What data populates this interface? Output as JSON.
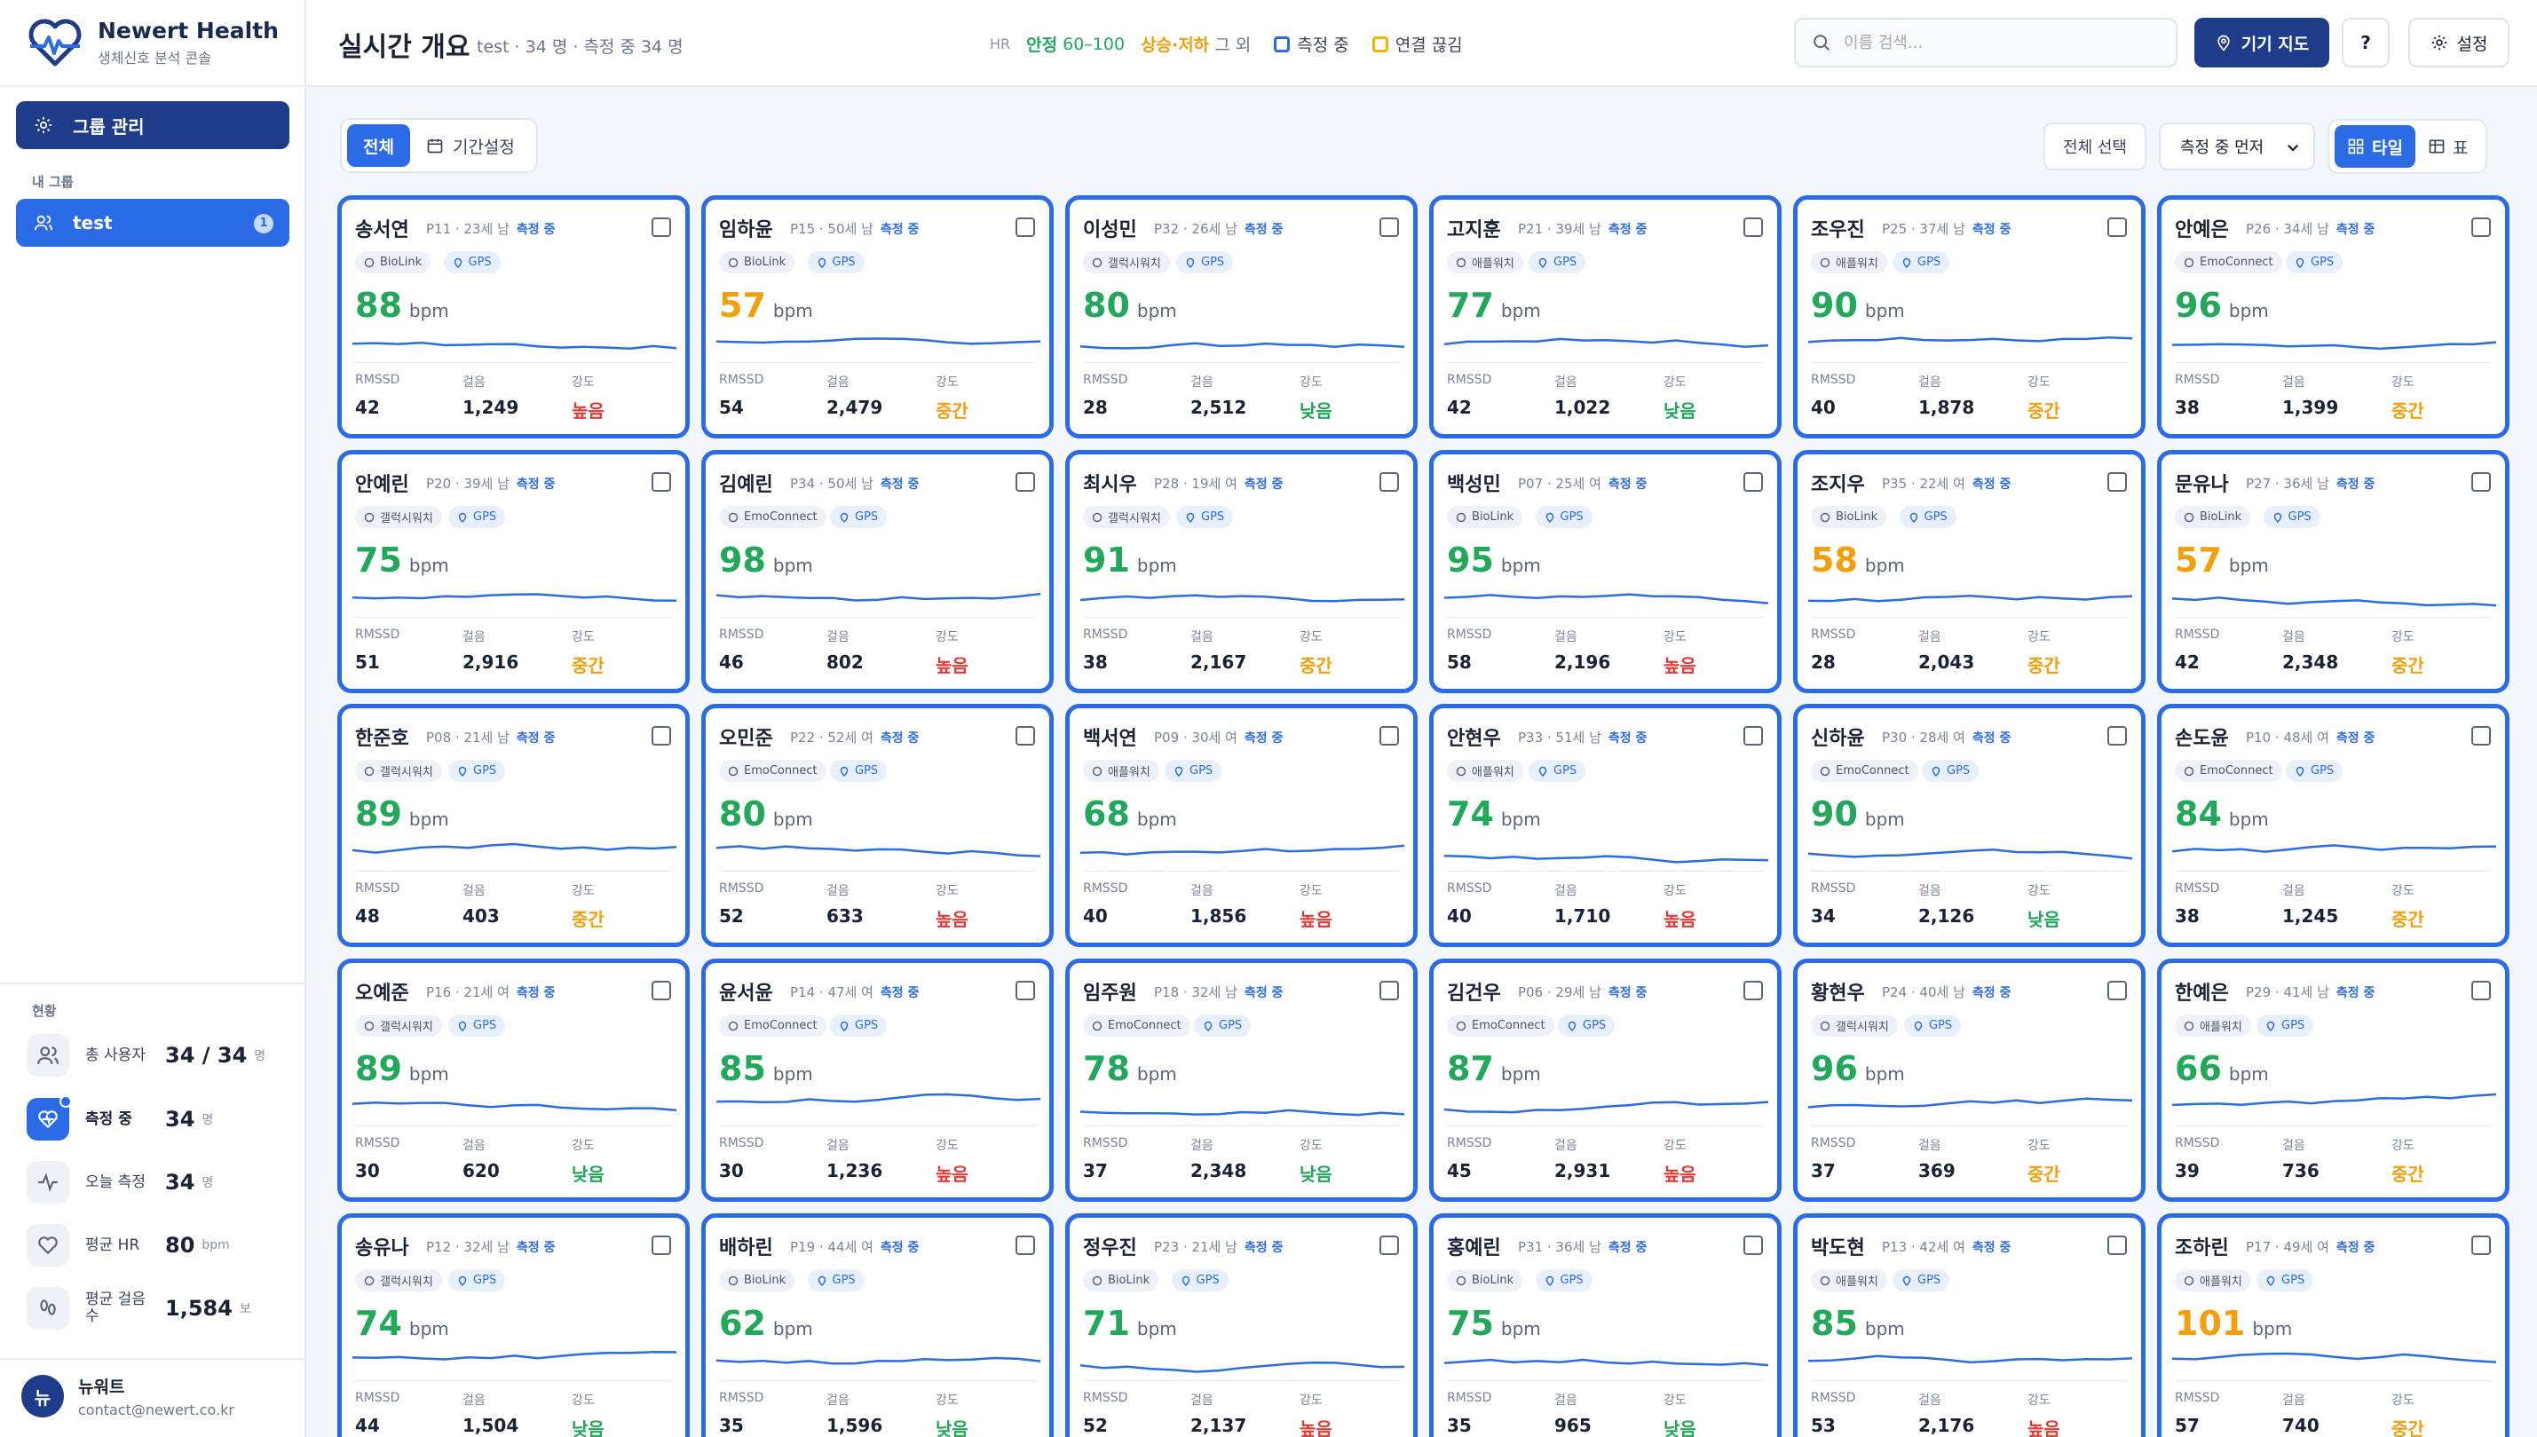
{
  "brand": {
    "name": "Newert Health",
    "subtitle": "생체신호 분석 콘솔"
  },
  "sidebar": {
    "manage_label": "그룹 관리",
    "my_groups_label": "내 그룹",
    "groups": [
      {
        "label": "test",
        "count": "1"
      }
    ],
    "status_label": "현황",
    "stats": [
      {
        "icon": "users-icon",
        "label": "총 사용자",
        "value": "34 / 34",
        "unit": "명"
      },
      {
        "icon": "heart-pulse-icon",
        "label": "측정 중",
        "value": "34",
        "unit": "명"
      },
      {
        "icon": "activity-icon",
        "label": "오늘 측정",
        "value": "34",
        "unit": "명"
      },
      {
        "icon": "heart-icon",
        "label": "평균 HR",
        "value": "80",
        "unit": "bpm"
      },
      {
        "icon": "footprints-icon",
        "label": "평균 걸음수",
        "value": "1,584",
        "unit": "보"
      }
    ],
    "user": {
      "avatar": "뉴",
      "name": "뉴워트",
      "email": "contact@newert.co.kr"
    }
  },
  "header": {
    "title": "실시간 개요",
    "meta": "test · 34 명 · 측정 중 34 명",
    "legend": {
      "hr": "HR",
      "stable": "안정",
      "stable_range": "60–100",
      "warn": "상승·저하",
      "warn_suffix": "그 외",
      "measuring": "측정 중",
      "disconnected": "연결 끊김"
    },
    "search_placeholder": "이름 검색...",
    "map_label": "기기 지도",
    "help_label": "?",
    "settings_label": "설정"
  },
  "toolbar": {
    "all_label": "전체",
    "period_label": "기간설정",
    "select_all_label": "전체 선택",
    "sort_label": "측정 중 먼저",
    "tile_label": "타일",
    "table_label": "표"
  },
  "card_labels": {
    "bpm_unit": "bpm",
    "rmssd": "RMSSD",
    "steps": "걸음",
    "intensity": "강도",
    "status": "측정 중",
    "gps": "GPS"
  },
  "colors": {
    "accent": "#2b6be6",
    "navy": "#1f3c8a",
    "good": "#22a85a",
    "warn": "#f59e0b",
    "bad": "#e53935"
  },
  "cards": [
    {
      "name": "송서연",
      "meta": "P11 · 23세 남",
      "device": "BioLink",
      "hr": 88,
      "rmssd": "42",
      "steps": "1,249",
      "intensity": "높음"
    },
    {
      "name": "임하윤",
      "meta": "P15 · 50세 남",
      "device": "BioLink",
      "hr": 57,
      "rmssd": "54",
      "steps": "2,479",
      "intensity": "중간"
    },
    {
      "name": "이성민",
      "meta": "P32 · 26세 남",
      "device": "갤럭시워치",
      "hr": 80,
      "rmssd": "28",
      "steps": "2,512",
      "intensity": "낮음"
    },
    {
      "name": "고지훈",
      "meta": "P21 · 39세 남",
      "device": "애플워치",
      "hr": 77,
      "rmssd": "42",
      "steps": "1,022",
      "intensity": "낮음"
    },
    {
      "name": "조우진",
      "meta": "P25 · 37세 남",
      "device": "애플워치",
      "hr": 90,
      "rmssd": "40",
      "steps": "1,878",
      "intensity": "중간"
    },
    {
      "name": "안예은",
      "meta": "P26 · 34세 남",
      "device": "EmoConnect",
      "hr": 96,
      "rmssd": "38",
      "steps": "1,399",
      "intensity": "중간"
    },
    {
      "name": "안예린",
      "meta": "P20 · 39세 남",
      "device": "갤럭시워치",
      "hr": 75,
      "rmssd": "51",
      "steps": "2,916",
      "intensity": "중간"
    },
    {
      "name": "김예린",
      "meta": "P34 · 50세 남",
      "device": "EmoConnect",
      "hr": 98,
      "rmssd": "46",
      "steps": "802",
      "intensity": "높음"
    },
    {
      "name": "최시우",
      "meta": "P28 · 19세 여",
      "device": "갤럭시워치",
      "hr": 91,
      "rmssd": "38",
      "steps": "2,167",
      "intensity": "중간"
    },
    {
      "name": "백성민",
      "meta": "P07 · 25세 여",
      "device": "BioLink",
      "hr": 95,
      "rmssd": "58",
      "steps": "2,196",
      "intensity": "높음"
    },
    {
      "name": "조지우",
      "meta": "P35 · 22세 여",
      "device": "BioLink",
      "hr": 58,
      "rmssd": "28",
      "steps": "2,043",
      "intensity": "중간"
    },
    {
      "name": "문유나",
      "meta": "P27 · 36세 남",
      "device": "BioLink",
      "hr": 57,
      "rmssd": "42",
      "steps": "2,348",
      "intensity": "중간"
    },
    {
      "name": "한준호",
      "meta": "P08 · 21세 남",
      "device": "갤럭시워치",
      "hr": 89,
      "rmssd": "48",
      "steps": "403",
      "intensity": "중간"
    },
    {
      "name": "오민준",
      "meta": "P22 · 52세 여",
      "device": "EmoConnect",
      "hr": 80,
      "rmssd": "52",
      "steps": "633",
      "intensity": "높음"
    },
    {
      "name": "백서연",
      "meta": "P09 · 30세 여",
      "device": "애플워치",
      "hr": 68,
      "rmssd": "40",
      "steps": "1,856",
      "intensity": "높음"
    },
    {
      "name": "안현우",
      "meta": "P33 · 51세 남",
      "device": "애플워치",
      "hr": 74,
      "rmssd": "40",
      "steps": "1,710",
      "intensity": "높음"
    },
    {
      "name": "신하윤",
      "meta": "P30 · 28세 여",
      "device": "EmoConnect",
      "hr": 90,
      "rmssd": "34",
      "steps": "2,126",
      "intensity": "낮음"
    },
    {
      "name": "손도윤",
      "meta": "P10 · 48세 여",
      "device": "EmoConnect",
      "hr": 84,
      "rmssd": "38",
      "steps": "1,245",
      "intensity": "중간"
    },
    {
      "name": "오예준",
      "meta": "P16 · 21세 여",
      "device": "갤럭시워치",
      "hr": 89,
      "rmssd": "30",
      "steps": "620",
      "intensity": "낮음"
    },
    {
      "name": "윤서윤",
      "meta": "P14 · 47세 여",
      "device": "EmoConnect",
      "hr": 85,
      "rmssd": "30",
      "steps": "1,236",
      "intensity": "높음"
    },
    {
      "name": "임주원",
      "meta": "P18 · 32세 남",
      "device": "EmoConnect",
      "hr": 78,
      "rmssd": "37",
      "steps": "2,348",
      "intensity": "낮음"
    },
    {
      "name": "김건우",
      "meta": "P06 · 29세 남",
      "device": "EmoConnect",
      "hr": 87,
      "rmssd": "45",
      "steps": "2,931",
      "intensity": "높음"
    },
    {
      "name": "황현우",
      "meta": "P24 · 40세 남",
      "device": "갤럭시워치",
      "hr": 96,
      "rmssd": "37",
      "steps": "369",
      "intensity": "중간"
    },
    {
      "name": "한예은",
      "meta": "P29 · 41세 남",
      "device": "애플워치",
      "hr": 66,
      "rmssd": "39",
      "steps": "736",
      "intensity": "중간"
    },
    {
      "name": "송유나",
      "meta": "P12 · 32세 남",
      "device": "갤럭시워치",
      "hr": 74,
      "rmssd": "44",
      "steps": "1,504",
      "intensity": "낮음"
    },
    {
      "name": "배하린",
      "meta": "P19 · 44세 여",
      "device": "BioLink",
      "hr": 62,
      "rmssd": "35",
      "steps": "1,596",
      "intensity": "낮음"
    },
    {
      "name": "정우진",
      "meta": "P23 · 21세 남",
      "device": "BioLink",
      "hr": 71,
      "rmssd": "52",
      "steps": "2,137",
      "intensity": "높음"
    },
    {
      "name": "홍예린",
      "meta": "P31 · 36세 남",
      "device": "BioLink",
      "hr": 75,
      "rmssd": "35",
      "steps": "965",
      "intensity": "낮음"
    },
    {
      "name": "박도현",
      "meta": "P13 · 42세 여",
      "device": "애플워치",
      "hr": 85,
      "rmssd": "53",
      "steps": "2,176",
      "intensity": "높음"
    },
    {
      "name": "조하린",
      "meta": "P17 · 49세 여",
      "device": "애플워치",
      "hr": 101,
      "rmssd": "57",
      "steps": "740",
      "intensity": "중간"
    }
  ]
}
